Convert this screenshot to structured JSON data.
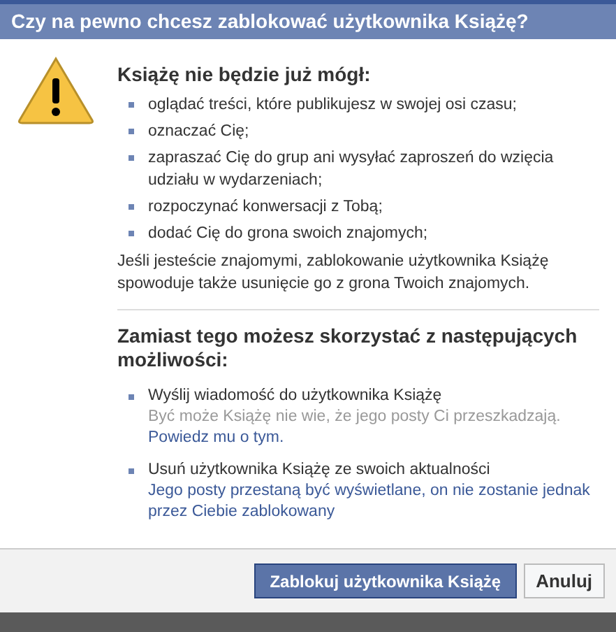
{
  "dialog": {
    "title": "Czy na pewno chcesz zablokować użytkownika Książę?"
  },
  "restrictions": {
    "heading": "Książę nie będzie już mógł:",
    "items": [
      "oglądać treści, które publikujesz w swojej osi czasu;",
      "oznaczać Cię;",
      "zapraszać Cię do grup ani wysyłać zaproszeń do wzięcia udziału w wydarzeniach;",
      "rozpoczynać konwersacji z Tobą;",
      "dodać Cię do grona swoich znajomych;"
    ],
    "note": "Jeśli jesteście znajomymi, zablokowanie użytkownika Książę spowoduje także usunięcie go z grona Twoich znajomych."
  },
  "alternatives": {
    "heading": "Zamiast tego możesz skorzystać z następujących możliwości:",
    "options": [
      {
        "kind": "message",
        "title": "Wyślij wiadomość do użytkownika Książę",
        "description": "Być może Książę nie wie, że jego posty Ci przeszkadzają.",
        "link": "Powiedz mu o tym."
      },
      {
        "kind": "unfollow",
        "title": "Usuń użytkownika Książę ze swoich aktualności",
        "description": "Jego posty przestaną być wyświetlane, on nie zostanie jednak przez Ciebie zablokowany"
      }
    ]
  },
  "buttons": [
    {
      "label": "Zablokuj użytkownika Książę",
      "kind": "primary"
    },
    {
      "label": "Anuluj",
      "kind": "secondary"
    }
  ]
}
